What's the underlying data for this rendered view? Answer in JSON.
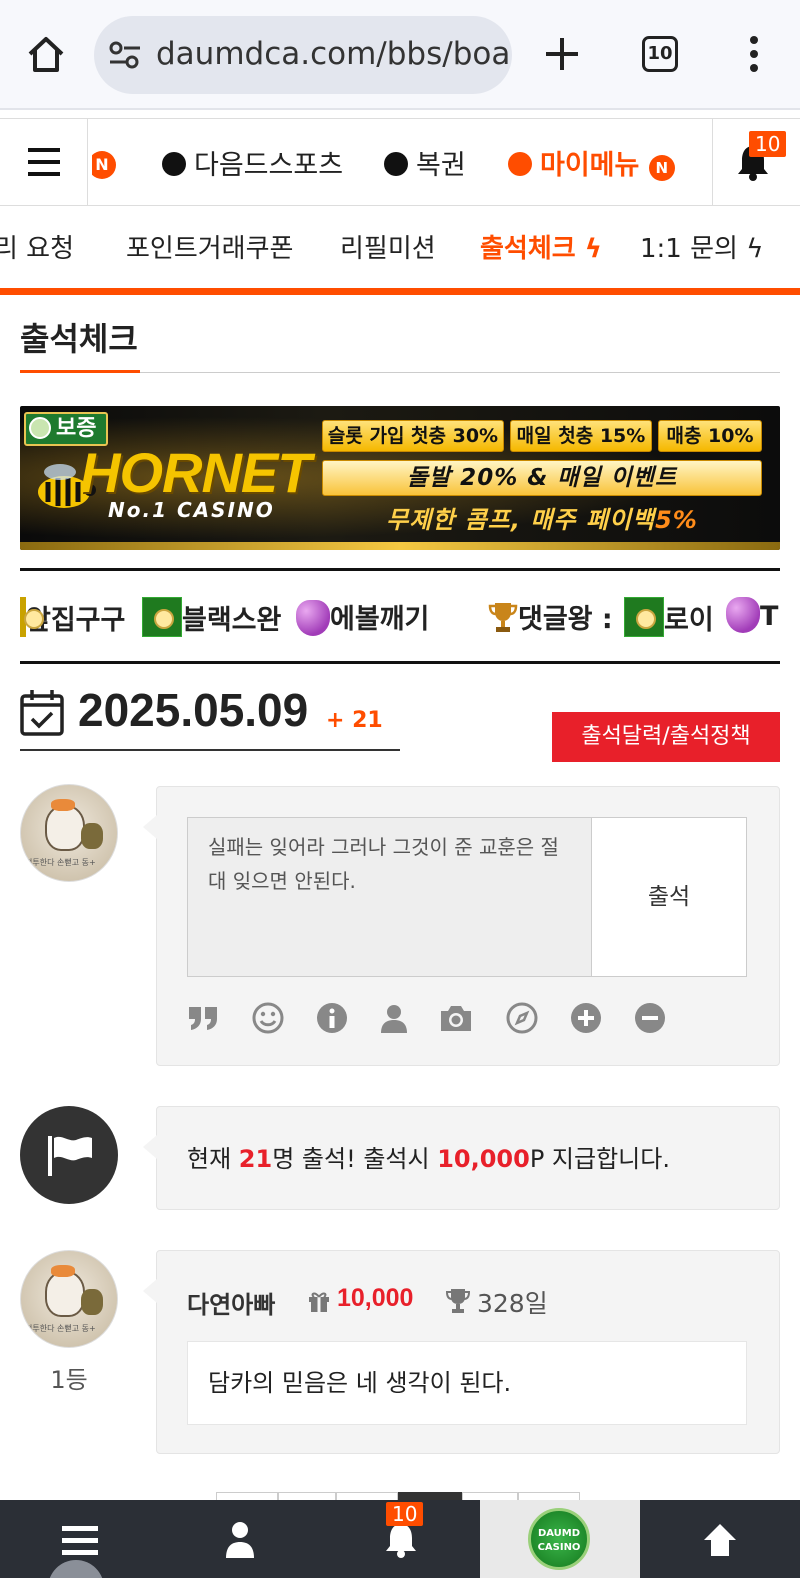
{
  "browser": {
    "url": "daumdca.com/bbs/board",
    "tab_count": "10"
  },
  "top_nav": {
    "partial_badge": "N",
    "items": [
      {
        "label": "다음드스포츠"
      },
      {
        "label": "복권"
      },
      {
        "label": "마이메뉴",
        "badge": "N"
      }
    ],
    "notification_count": "10"
  },
  "sub_nav": {
    "items": [
      {
        "label": "리 요청"
      },
      {
        "label": "포인트거래쿠폰"
      },
      {
        "label": "리필미션"
      },
      {
        "label": "출석체크 ϟ",
        "active": true
      },
      {
        "label": "1:1 문의 ϟ"
      }
    ]
  },
  "page": {
    "title": "출석체크"
  },
  "banner": {
    "badge": "보증",
    "brand": "HORNET",
    "tagline": "No.1 CASINO",
    "promos": [
      "슬롯 가입 첫충 30%",
      "매일 첫충 15%",
      "매충 10%"
    ],
    "line2": "돌발 20% & 매일 이벤트",
    "line3_prefix": "무제한 콤프, 매주 페이백",
    "line3_highlight": "5%"
  },
  "ticker": {
    "items": [
      "앞집구구",
      "블랙스완",
      "에볼깨기",
      "댓글왕 :",
      "로이",
      "T"
    ]
  },
  "attendance": {
    "date": "2025.05.09",
    "count_label": "+ 21",
    "policy_button": "출석달력/출석정책",
    "textarea_value": "실패는 잊어라 그러나 그것이 준 교훈은 절대 잊으면 안된다.",
    "submit_label": "출석",
    "summary_prefix": "현재 ",
    "summary_count": "21",
    "summary_mid": "명 출석! 출석시 ",
    "summary_points": "10,000",
    "summary_suffix": "P 지급합니다."
  },
  "entries": [
    {
      "rank": "1등",
      "name": "다연아빠",
      "points": "10,000",
      "days": "328일",
      "message": "담카의 믿음은 네 생각이 된다."
    }
  ],
  "avatar_caption": "전투한다 손뻗고 동+",
  "bottom_bar": {
    "notification_count": "10",
    "logo_text": "DAUMD CASINO"
  },
  "colors": {
    "accent": "#ff4d00",
    "danger": "#e8202a",
    "dark": "#2b2f36"
  }
}
